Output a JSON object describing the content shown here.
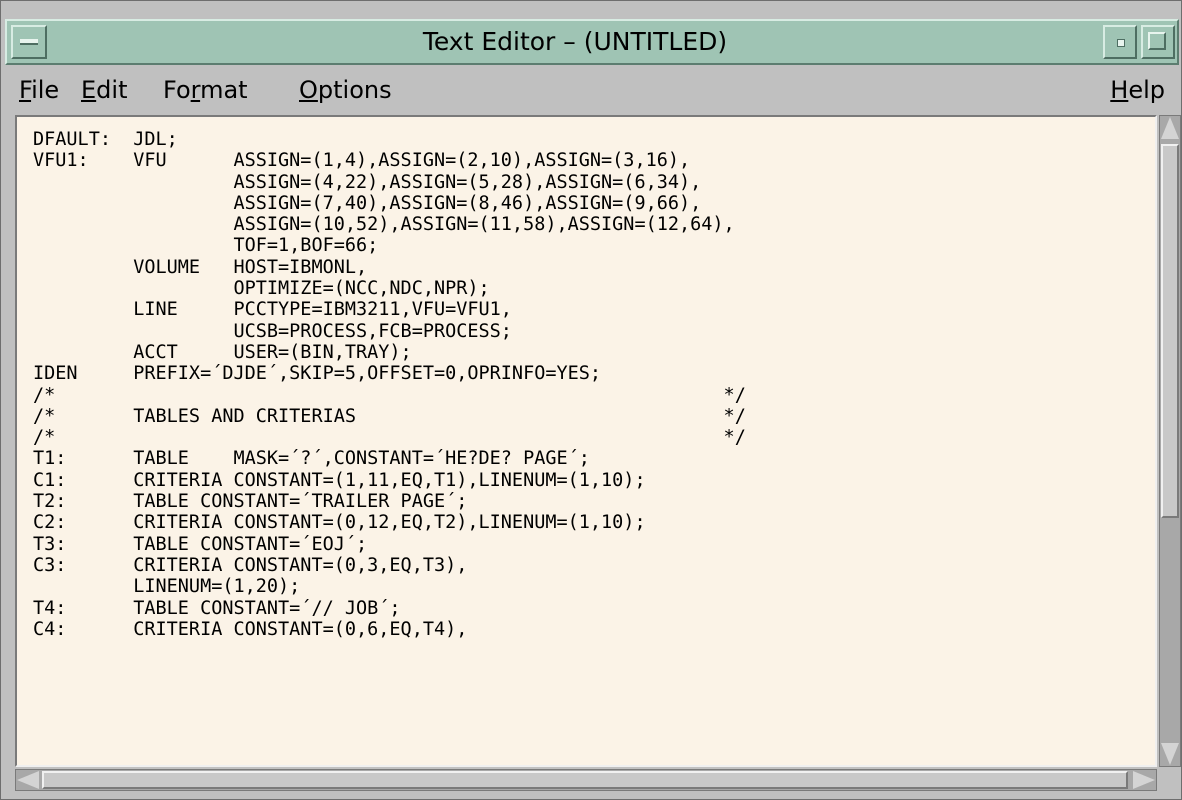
{
  "window": {
    "title": "Text Editor – (UNTITLED)",
    "title_bar_color": "#9fc4b4",
    "editor_background": "#fbf3e7"
  },
  "menubar": {
    "file": {
      "mnemonic": "F",
      "rest": "ile"
    },
    "edit": {
      "mnemonic": "E",
      "rest": "dit"
    },
    "format": {
      "before": "Fo",
      "mnemonic": "r",
      "after": "mat"
    },
    "options": {
      "mnemonic": "O",
      "rest": "ptions"
    },
    "help": {
      "mnemonic": "H",
      "rest": "elp"
    }
  },
  "editor": {
    "lines": [
      "DFAULT:  JDL;",
      "VFU1:    VFU      ASSIGN=(1,4),ASSIGN=(2,10),ASSIGN=(3,16),",
      "                  ASSIGN=(4,22),ASSIGN=(5,28),ASSIGN=(6,34),",
      "                  ASSIGN=(7,40),ASSIGN=(8,46),ASSIGN=(9,66),",
      "                  ASSIGN=(10,52),ASSIGN=(11,58),ASSIGN=(12,64),",
      "                  TOF=1,BOF=66;",
      "         VOLUME   HOST=IBMONL,",
      "                  OPTIMIZE=(NCC,NDC,NPR);",
      "         LINE     PCCTYPE=IBM3211,VFU=VFU1,",
      "                  UCSB=PROCESS,FCB=PROCESS;",
      "         ACCT     USER=(BIN,TRAY);",
      "IDEN     PREFIX=´DJDE´,SKIP=5,OFFSET=0,OPRINFO=YES;",
      "/*                                                            */",
      "/*       TABLES AND CRITERIAS                                 */",
      "/*                                                            */",
      "T1:      TABLE    MASK=´?´,CONSTANT=´HE?DE? PAGE´;",
      "C1:      CRITERIA CONSTANT=(1,11,EQ,T1),LINENUM=(1,10);",
      "T2:      TABLE CONSTANT=´TRAILER PAGE´;",
      "C2:      CRITERIA CONSTANT=(0,12,EQ,T2),LINENUM=(1,10);",
      "T3:      TABLE CONSTANT=´EOJ´;",
      "C3:      CRITERIA CONSTANT=(0,3,EQ,T3),",
      "         LINENUM=(1,20);",
      "T4:      TABLE CONSTANT=´// JOB´;",
      "C4:      CRITERIA CONSTANT=(0,6,EQ,T4),"
    ]
  }
}
